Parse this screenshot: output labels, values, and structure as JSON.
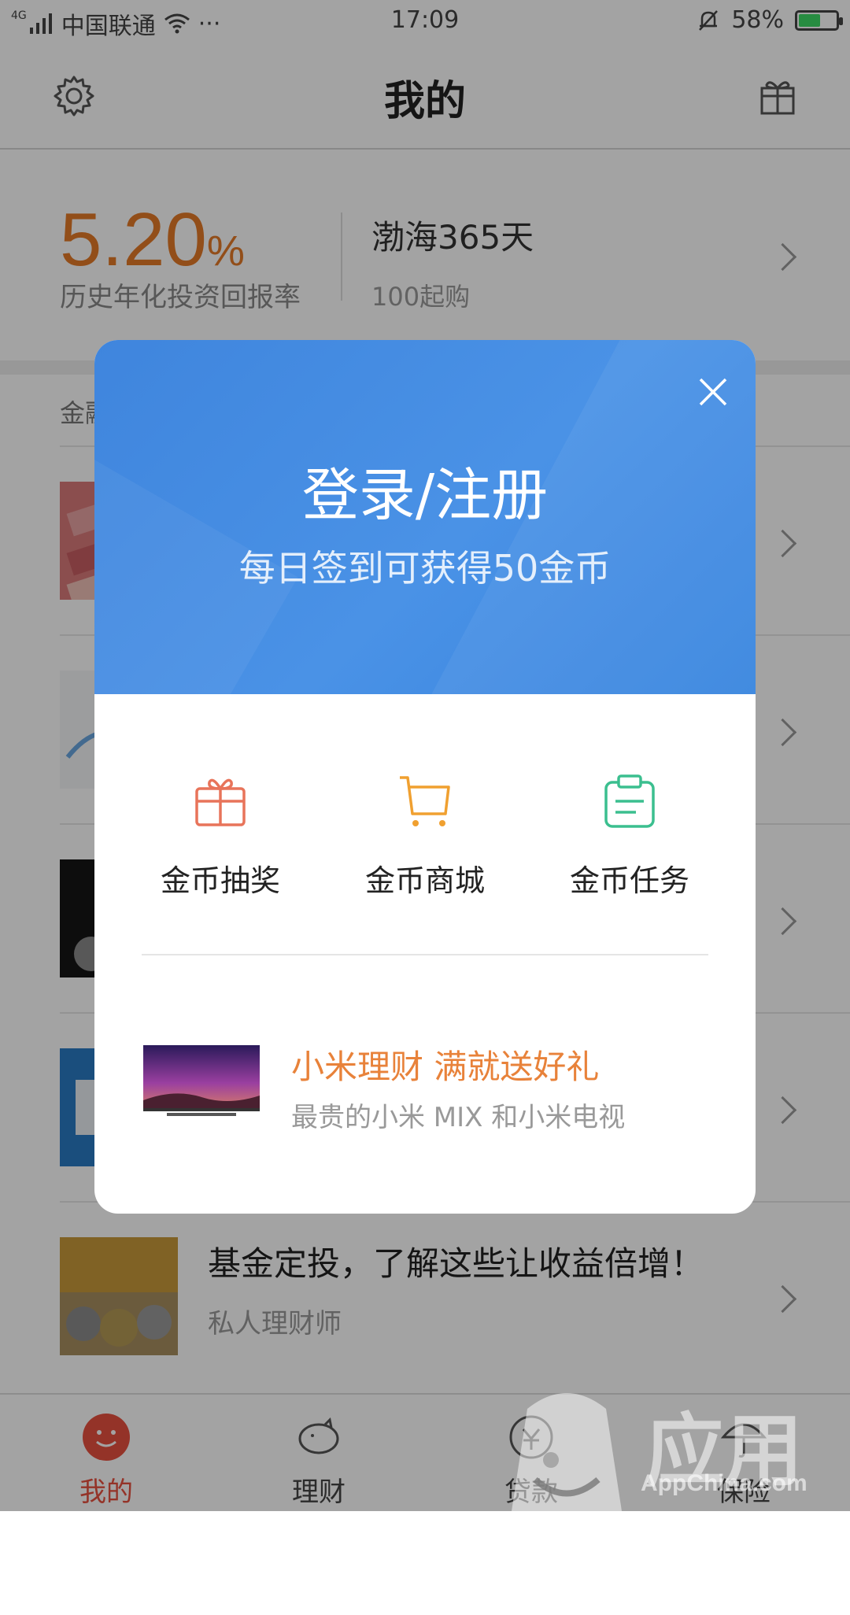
{
  "status_bar": {
    "network": "4G",
    "carrier": "中国联通",
    "more": "···",
    "time": "17:09",
    "battery": "58%",
    "battery_level": 0.58
  },
  "header": {
    "title": "我的",
    "left_icon": "gear-icon",
    "right_icon": "gift-icon"
  },
  "featured_product": {
    "rate": "5.20",
    "rate_unit": "%",
    "rate_label": "历史年化投资回报率",
    "name": "渤海365天",
    "min_purchase": "100起购"
  },
  "section": {
    "title": "金融"
  },
  "articles": [
    {
      "title": "",
      "subtitle": ""
    },
    {
      "title": "",
      "subtitle": ""
    },
    {
      "title": "",
      "subtitle": ""
    },
    {
      "title": "",
      "subtitle": ""
    },
    {
      "title": "基金定投，了解这些让收益倍增！",
      "subtitle": "私人理财师"
    }
  ],
  "modal": {
    "title": "登录/注册",
    "subtitle": "每日签到可获得50金币",
    "features": [
      {
        "label": "金币抽奖",
        "icon": "gift-box-icon",
        "color": "#e8745a"
      },
      {
        "label": "金币商城",
        "icon": "cart-icon",
        "color": "#f0a030"
      },
      {
        "label": "金币任务",
        "icon": "clipboard-icon",
        "color": "#3bbf8f"
      }
    ],
    "promo": {
      "title": "小米理财  满就送好礼",
      "subtitle": "最贵的小米 MIX 和小米电视"
    }
  },
  "tabs": [
    {
      "label": "我的",
      "icon": "smile-icon",
      "active": true
    },
    {
      "label": "理财",
      "icon": "piggy-bank-icon",
      "active": false
    },
    {
      "label": "贷款",
      "icon": "loan-icon",
      "active": false
    },
    {
      "label": "保险",
      "icon": "umbrella-icon",
      "active": false
    }
  ],
  "watermark": {
    "text": "应用汇",
    "url": "AppChina.com"
  },
  "colors": {
    "accent_orange": "#e57a28",
    "modal_blue": "#4a8ee4",
    "tab_active": "#e8503f"
  }
}
